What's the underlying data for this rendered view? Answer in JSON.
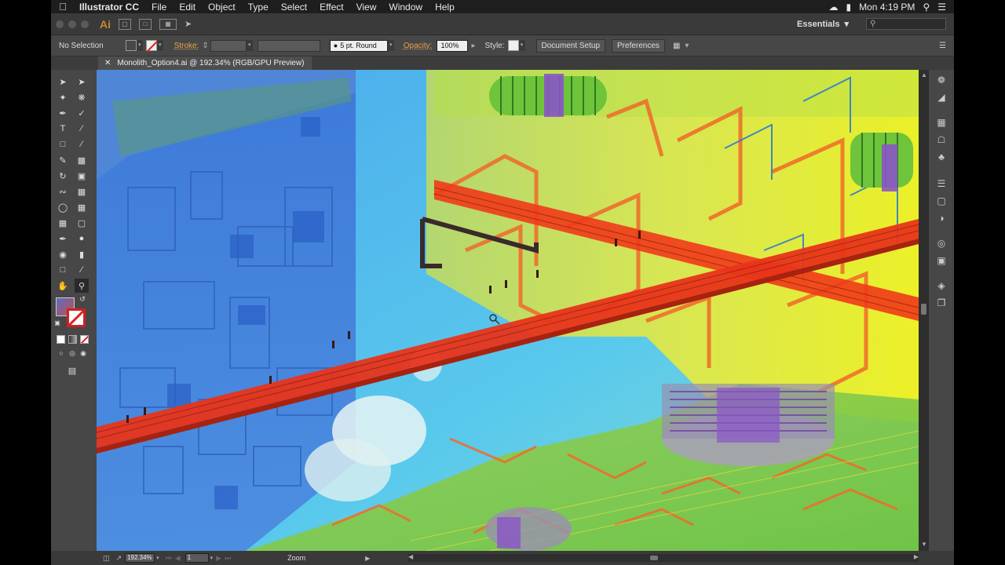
{
  "menubar": {
    "app_name": "Illustrator CC",
    "items": [
      "File",
      "Edit",
      "Object",
      "Type",
      "Select",
      "Effect",
      "View",
      "Window",
      "Help"
    ],
    "clock": "Mon 4:19 PM"
  },
  "appbar": {
    "logo": "Ai",
    "workspace": "Essentials"
  },
  "controlbar": {
    "selection": "No Selection",
    "stroke_label": "Stroke:",
    "brush": "5 pt. Round",
    "opacity_label": "Opacity:",
    "opacity_value": "100%",
    "style_label": "Style:",
    "document_setup": "Document Setup",
    "preferences": "Preferences"
  },
  "document": {
    "tab_title": "Monolith_Option4.ai @ 192.34% (RGB/GPU Preview)"
  },
  "statusbar": {
    "zoom": "192.34%",
    "artboard": "1",
    "tool": "Zoom"
  },
  "colors": {
    "menubar_bg": "#1e1e1e",
    "panel_bg": "#474747",
    "accent": "#e8a54b",
    "ai_logo": "#c98a2a"
  },
  "icons": {
    "apple": "apple-icon",
    "search": "search-icon",
    "wifi": "wifi-icon",
    "battery": "battery-icon",
    "list": "list-icon"
  }
}
